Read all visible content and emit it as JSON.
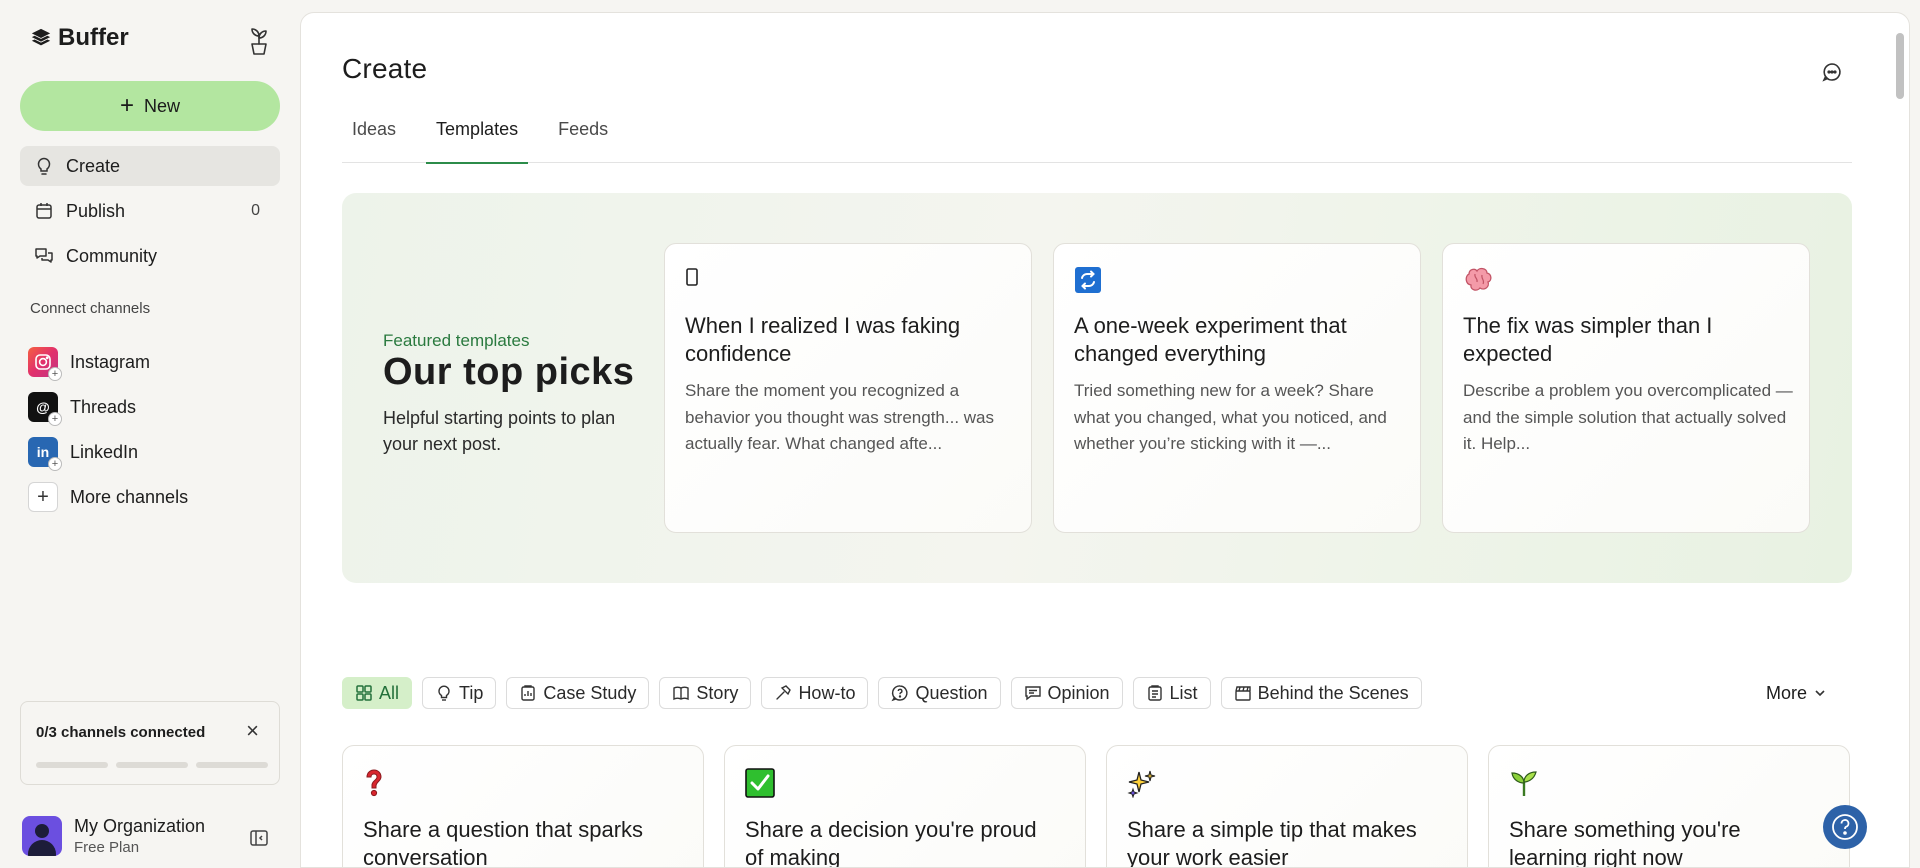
{
  "brand": {
    "name": "Buffer"
  },
  "sidebar": {
    "new_label": "New",
    "nav": [
      {
        "label": "Create",
        "icon": "lightbulb-icon"
      },
      {
        "label": "Publish",
        "icon": "calendar-icon",
        "count": "0"
      },
      {
        "label": "Community",
        "icon": "chat-bubbles-icon"
      }
    ],
    "connect_label": "Connect channels",
    "channels": [
      {
        "label": "Instagram",
        "icon": "instagram-icon"
      },
      {
        "label": "Threads",
        "icon": "threads-icon"
      },
      {
        "label": "LinkedIn",
        "icon": "linkedin-icon"
      },
      {
        "label": "More channels",
        "icon": "plus-icon"
      }
    ],
    "connection_status": "0/3 channels connected",
    "org_name": "My Organization",
    "org_plan": "Free Plan"
  },
  "main": {
    "title": "Create",
    "tabs": [
      "Ideas",
      "Templates",
      "Feeds"
    ],
    "active_tab": "Templates",
    "featured": {
      "label": "Featured templates",
      "title": "Our top picks",
      "description": "Helpful starting points to plan your next post.",
      "cards": [
        {
          "icon": "phone-icon",
          "glyph": "▯",
          "title": "When I realized I was faking confidence",
          "description": "Share the moment you recognized a behavior you thought was strength... was actually fear. What changed afte..."
        },
        {
          "icon": "repeat-icon",
          "glyph": "🔁",
          "title": "A one-week experiment that changed everything",
          "description": "Tried something new for a week? Share what you changed, what you noticed, and whether you’re sticking with it —..."
        },
        {
          "icon": "brain-icon",
          "glyph": "🧠",
          "title": "The fix was simpler than I expected",
          "description": "Describe a problem you overcomplicated — and the simple solution that actually solved it. Help..."
        }
      ]
    },
    "filters": [
      "All",
      "Tip",
      "Case Study",
      "Story",
      "How-to",
      "Question",
      "Opinion",
      "List",
      "Behind the Scenes"
    ],
    "more_label": "More",
    "templates": [
      {
        "icon": "question-mark-icon",
        "glyph": "❓",
        "title": "Share a question that sparks conversation"
      },
      {
        "icon": "checkmark-icon",
        "glyph": "✅",
        "title": "Share a decision you're proud of making"
      },
      {
        "icon": "sparkles-icon",
        "glyph": "✨",
        "title": "Share a simple tip that makes your work easier"
      },
      {
        "icon": "seedling-icon",
        "glyph": "🌱",
        "title": "Share something you're learning right now"
      }
    ]
  },
  "colors": {
    "accent": "#b3e6a0",
    "tab_underline": "#2c8c4a",
    "featured_label": "#2a7a3f",
    "help": "#2d62a8"
  }
}
